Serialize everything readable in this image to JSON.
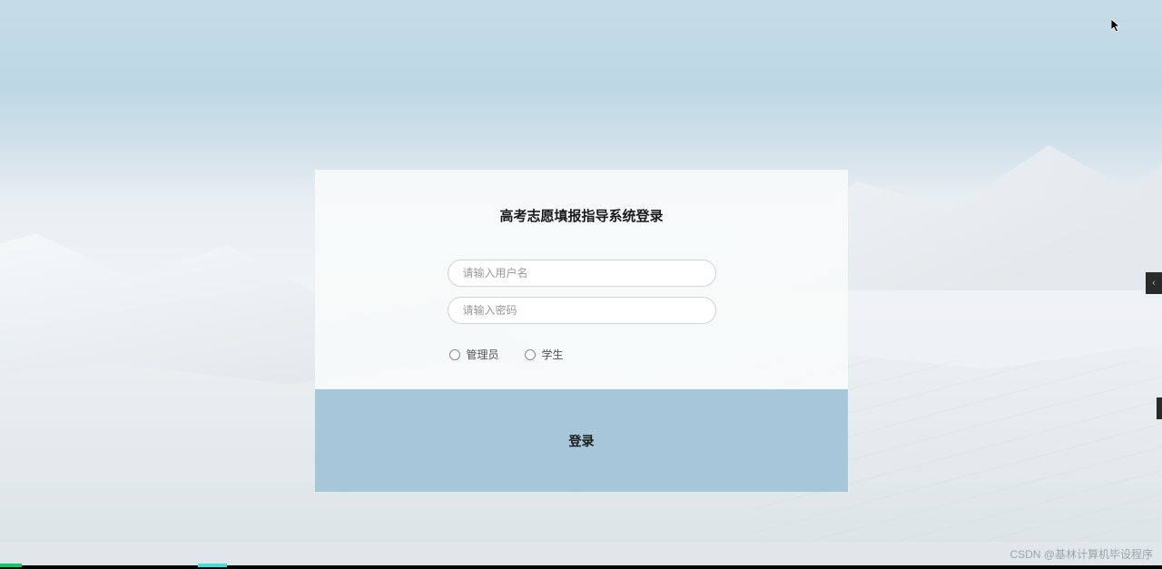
{
  "login": {
    "title": "高考志愿填报指导系统登录",
    "username_placeholder": "请输入用户名",
    "password_placeholder": "请输入密码",
    "roles": {
      "admin": "管理员",
      "student": "学生"
    },
    "button_label": "登录"
  },
  "watermark": "CSDN @基林计算机毕设程序",
  "side_tab_glyph": "‹",
  "colors": {
    "button_bg": "#a6c7da",
    "card_bg": "rgba(248,250,251,0.88)"
  }
}
